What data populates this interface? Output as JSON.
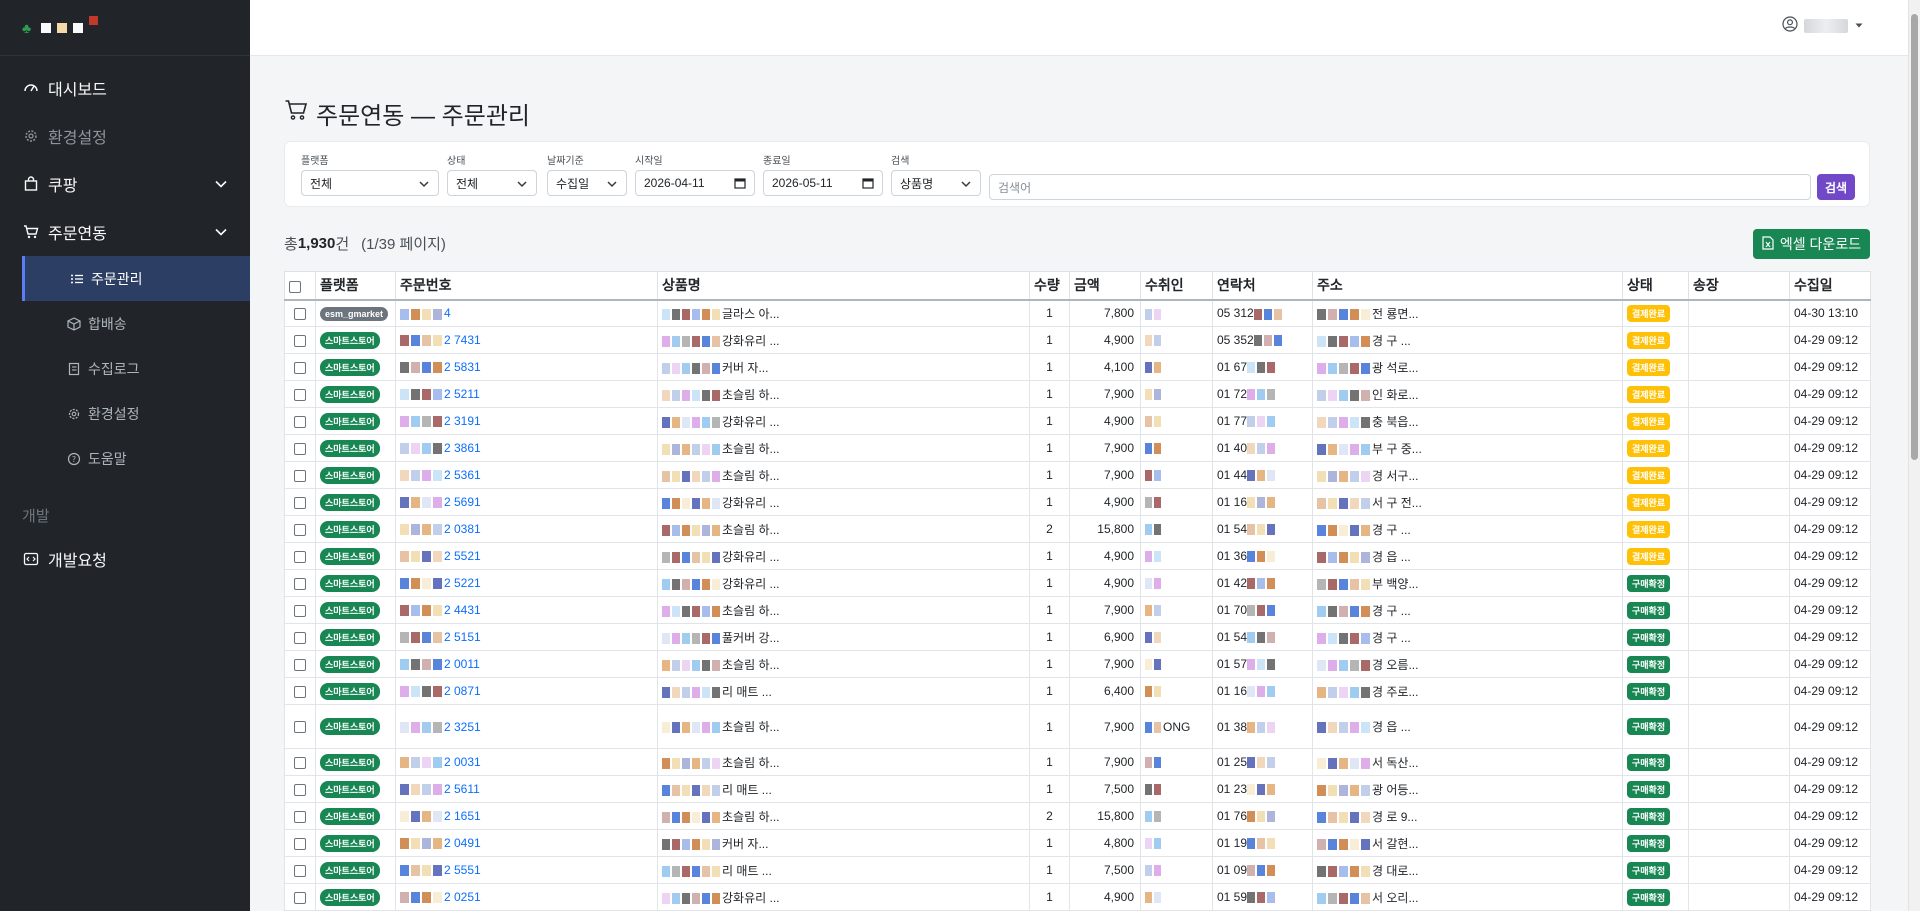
{
  "sidebar": {
    "menu": [
      {
        "label": "대시보드"
      },
      {
        "label": "환경설정"
      },
      {
        "label": "쿠팡"
      },
      {
        "label": "주문연동"
      }
    ],
    "orders_sub": [
      {
        "label": "주문관리"
      },
      {
        "label": "합배송"
      },
      {
        "label": "수집로그"
      },
      {
        "label": "환경설정"
      },
      {
        "label": "도움말"
      }
    ],
    "dev_section_label": "개발",
    "dev_request_label": "개발요청"
  },
  "page": {
    "title": "주문연동 — 주문관리"
  },
  "filters": {
    "platform": {
      "label": "플랫폼",
      "value": "전체"
    },
    "status": {
      "label": "상태",
      "value": "전체"
    },
    "date_basis": {
      "label": "날짜기준",
      "value": "수집일"
    },
    "start_date": {
      "label": "시작일",
      "value": "2026-04-11"
    },
    "end_date": {
      "label": "종료일",
      "value": "2026-05-11"
    },
    "search_field": {
      "label": "검색",
      "value": "상품명"
    },
    "search_placeholder": "검색어",
    "search_button": "검색"
  },
  "summary": {
    "prefix": "총 ",
    "count": "1,930",
    "suffix": "건",
    "pages": "(1/39 페이지)"
  },
  "excel_button": "엑셀 다운로드",
  "table": {
    "headers": [
      "플랫폼",
      "주문번호",
      "상품명",
      "수량",
      "금액",
      "수취인",
      "연락처",
      "주소",
      "상태",
      "송장",
      "수집일"
    ],
    "rows": [
      {
        "platform": "esm_gmarket",
        "order": "4",
        "product": "글라스 아...",
        "qty": "1",
        "amount": "7,800",
        "recipient": "",
        "phone": "05  312",
        "address": "전  룡면...",
        "status": "결제완료",
        "invoice": "",
        "collected": "04-30 13:10"
      },
      {
        "platform": "스마트스토어",
        "order": "2  7431",
        "product": "강화유리 ...",
        "qty": "1",
        "amount": "4,900",
        "recipient": "",
        "phone": "05  352",
        "address": "경  구 ...",
        "status": "결제완료",
        "invoice": "",
        "collected": "04-29 09:12"
      },
      {
        "platform": "스마트스토어",
        "order": "2  5831",
        "product": "커버 자...",
        "qty": "1",
        "amount": "4,100",
        "recipient": "",
        "phone": "01  67",
        "address": "광  석로...",
        "status": "결제완료",
        "invoice": "",
        "collected": "04-29 09:12"
      },
      {
        "platform": "스마트스토어",
        "order": "2  5211",
        "product": "초슬림 하...",
        "qty": "1",
        "amount": "7,900",
        "recipient": "",
        "phone": "01  72",
        "address": "인  화로...",
        "status": "결제완료",
        "invoice": "",
        "collected": "04-29 09:12"
      },
      {
        "platform": "스마트스토어",
        "order": "2  3191",
        "product": "강화유리 ...",
        "qty": "1",
        "amount": "4,900",
        "recipient": "",
        "phone": "01  77",
        "address": "충  북읍...",
        "status": "결제완료",
        "invoice": "",
        "collected": "04-29 09:12"
      },
      {
        "platform": "스마트스토어",
        "order": "2  3861",
        "product": "초슬림 하...",
        "qty": "1",
        "amount": "7,900",
        "recipient": "",
        "phone": "01  40",
        "address": "부  구 중...",
        "status": "결제완료",
        "invoice": "",
        "collected": "04-29 09:12"
      },
      {
        "platform": "스마트스토어",
        "order": "2  5361",
        "product": "초슬림 하...",
        "qty": "1",
        "amount": "7,900",
        "recipient": "",
        "phone": "01  44",
        "address": "경  서구...",
        "status": "결제완료",
        "invoice": "",
        "collected": "04-29 09:12"
      },
      {
        "platform": "스마트스토어",
        "order": "2  5691",
        "product": "강화유리 ...",
        "qty": "1",
        "amount": "4,900",
        "recipient": "",
        "phone": "01  16",
        "address": "서  구 전...",
        "status": "결제완료",
        "invoice": "",
        "collected": "04-29 09:12"
      },
      {
        "platform": "스마트스토어",
        "order": "2  0381",
        "product": "초슬림 하...",
        "qty": "2",
        "amount": "15,800",
        "recipient": "",
        "phone": "01  54",
        "address": "경  구 ...",
        "status": "결제완료",
        "invoice": "",
        "collected": "04-29 09:12"
      },
      {
        "platform": "스마트스토어",
        "order": "2  5521",
        "product": "강화유리 ...",
        "qty": "1",
        "amount": "4,900",
        "recipient": "",
        "phone": "01  36",
        "address": "경  읍 ...",
        "status": "결제완료",
        "invoice": "",
        "collected": "04-29 09:12"
      },
      {
        "platform": "스마트스토어",
        "order": "2  5221",
        "product": "강화유리 ...",
        "qty": "1",
        "amount": "4,900",
        "recipient": "",
        "phone": "01  42",
        "address": "부  백양...",
        "status": "구매확정",
        "invoice": "",
        "collected": "04-29 09:12"
      },
      {
        "platform": "스마트스토어",
        "order": "2  4431",
        "product": "초슬림 하...",
        "qty": "1",
        "amount": "7,900",
        "recipient": "",
        "phone": "01  70",
        "address": "경  구 ...",
        "status": "구매확정",
        "invoice": "",
        "collected": "04-29 09:12"
      },
      {
        "platform": "스마트스토어",
        "order": "2  5151",
        "product": "풀커버 강...",
        "qty": "1",
        "amount": "6,900",
        "recipient": "",
        "phone": "01  54",
        "address": "경  구 ...",
        "status": "구매확정",
        "invoice": "",
        "collected": "04-29 09:12"
      },
      {
        "platform": "스마트스토어",
        "order": "2  0011",
        "product": "초슬림 하...",
        "qty": "1",
        "amount": "7,900",
        "recipient": "",
        "phone": "01  57",
        "address": "경  오름...",
        "status": "구매확정",
        "invoice": "",
        "collected": "04-29 09:12"
      },
      {
        "platform": "스마트스토어",
        "order": "2  0871",
        "product": "리 매트 ...",
        "qty": "1",
        "amount": "6,400",
        "recipient": "",
        "phone": "01  16",
        "address": "경  주로...",
        "status": "구매확정",
        "invoice": "",
        "collected": "04-29 09:12"
      },
      {
        "platform": "스마트스토어",
        "order": "2  3251",
        "product": "초슬림 하...",
        "qty": "1",
        "amount": "7,900",
        "recipient": "ONG",
        "phone": "01  38",
        "address": "경  읍 ...",
        "status": "구매확정",
        "invoice": "",
        "collected": "04-29 09:12",
        "tall": true
      },
      {
        "platform": "스마트스토어",
        "order": "2  0031",
        "product": "초슬림 하...",
        "qty": "1",
        "amount": "7,900",
        "recipient": "",
        "phone": "01  25",
        "address": "서  독산...",
        "status": "구매확정",
        "invoice": "",
        "collected": "04-29 09:12"
      },
      {
        "platform": "스마트스토어",
        "order": "2  5611",
        "product": "리 매트 ...",
        "qty": "1",
        "amount": "7,500",
        "recipient": "",
        "phone": "01  23",
        "address": "광  어등...",
        "status": "구매확정",
        "invoice": "",
        "collected": "04-29 09:12"
      },
      {
        "platform": "스마트스토어",
        "order": "2  1651",
        "product": "초슬림 하...",
        "qty": "2",
        "amount": "15,800",
        "recipient": "",
        "phone": "01  76",
        "address": "경  로 9...",
        "status": "구매확정",
        "invoice": "",
        "collected": "04-29 09:12"
      },
      {
        "platform": "스마트스토어",
        "order": "2  0491",
        "product": "커버 자...",
        "qty": "1",
        "amount": "4,800",
        "recipient": "",
        "phone": "01  19",
        "address": "서  갈현...",
        "status": "구매확정",
        "invoice": "",
        "collected": "04-29 09:12"
      },
      {
        "platform": "스마트스토어",
        "order": "2  5551",
        "product": "리 매트 ...",
        "qty": "1",
        "amount": "7,500",
        "recipient": "",
        "phone": "01  09",
        "address": "경  대로...",
        "status": "구매확정",
        "invoice": "",
        "collected": "04-29 09:12"
      },
      {
        "platform": "스마트스토어",
        "order": "2  0251",
        "product": "강화유리 ...",
        "qty": "1",
        "amount": "4,900",
        "recipient": "",
        "phone": "01  59",
        "address": "서  오리...",
        "status": "구매확정",
        "invoice": "",
        "collected": "04-29 09:12"
      }
    ]
  },
  "colors": {
    "sidebar_bg": "#212529",
    "active_bg": "#2c3e63",
    "excel_green": "#198754",
    "search_purple": "#7048c8",
    "status_paid": "#ffc107",
    "status_confirmed": "#198754",
    "link_blue": "#0d6efd"
  },
  "icons": {
    "dashboard": "speedometer-icon",
    "settings": "gear-icon",
    "coupang": "bag-icon",
    "orders": "cart-icon",
    "list": "list-icon",
    "box": "box-icon",
    "log": "journal-icon",
    "help": "question-circle-icon",
    "dev": "code-icon",
    "user": "person-circle-icon",
    "excel": "file-excel-icon"
  }
}
